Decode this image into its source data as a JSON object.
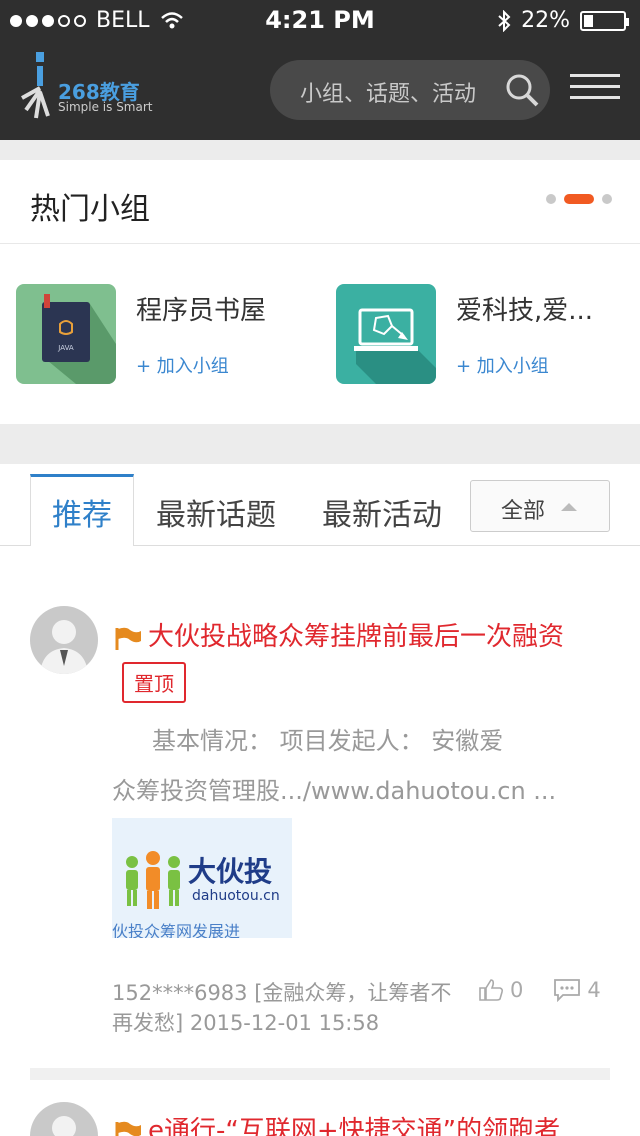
{
  "status": {
    "carrier": "BELL",
    "time": "4:21 PM",
    "battery": "22%"
  },
  "header": {
    "brand": "268教育",
    "tagline": "Simple is Smart",
    "search_placeholder": "小组、话题、活动"
  },
  "hot_groups": {
    "title": "热门小组",
    "groups": [
      {
        "name": "程序员书屋",
        "join": "+ 加入小组"
      },
      {
        "name": "爱科技,爱...",
        "join": "+ 加入小组"
      }
    ]
  },
  "tabs": {
    "items": [
      "推荐",
      "最新话题",
      "最新活动"
    ],
    "filter": "全部"
  },
  "posts": [
    {
      "title": "大伙投战略众筹挂牌前最后一次融资",
      "pinned": "置顶",
      "excerpt_line1": "基本情况：      项目发起人：  安徽爱",
      "excerpt_line2": "众筹投资管理股.../www.dahuotou.cn ...",
      "thumb_brand": "大伙投",
      "thumb_domain": "dahuotou.cn",
      "thumb_caption": "伙投众筹网发展进",
      "meta_line1": "152****6983  [金融众筹，让筹者不",
      "meta_line2": "再发愁]    2015-12-01 15:58",
      "likes": "0",
      "comments": "4"
    },
    {
      "title": "e通行-“互联网+快捷交通”的领跑者"
    }
  ],
  "colors": {
    "header_bg": "#2f2f2f",
    "accent_blue": "#2f80c9",
    "accent_orange": "#f15a22",
    "title_red": "#e0282e"
  }
}
